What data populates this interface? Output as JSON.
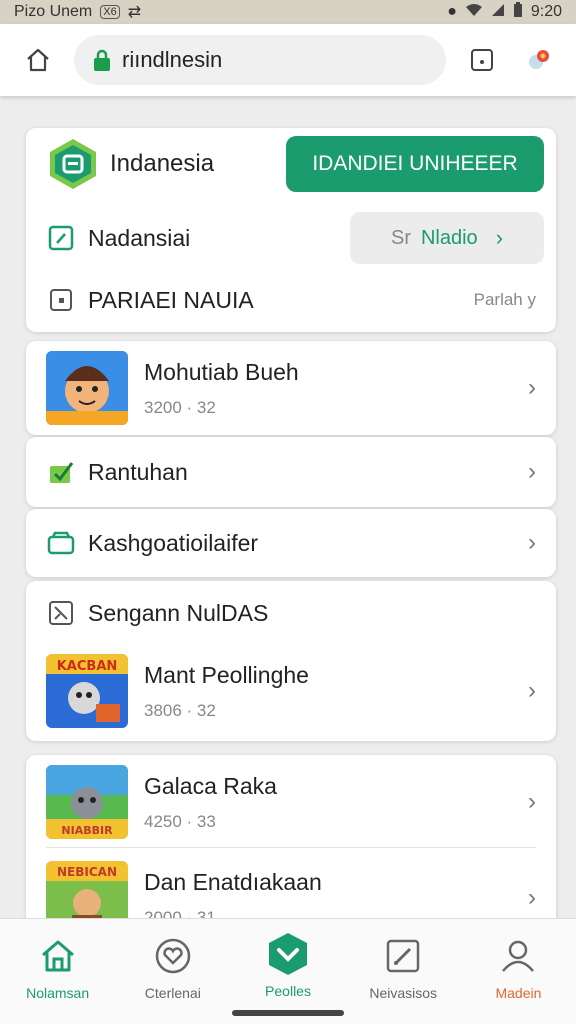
{
  "status_bar": {
    "left_text": "Pizo Unem",
    "badge": "X6",
    "time": "9:20"
  },
  "browser": {
    "url": "riındlnesin"
  },
  "top_card": {
    "brand_title": "Indanesia",
    "primary_button": "IDANDIEI UNIHEEER",
    "row2_label": "Nadansiai",
    "secondary_button_prefix": "Sr",
    "secondary_button_label": "Nladio",
    "row3_label": "PARIAEI NAUIA",
    "row3_value": "Parlah y"
  },
  "list_card_1": {
    "title": "Mohutiab Bueh",
    "sub": "3200 · 32"
  },
  "list_row_rantuhan": {
    "label": "Rantuhan"
  },
  "list_row_kash": {
    "label": "Kashgoatioilaifer"
  },
  "section_card": {
    "header": "Sengann NulDAS",
    "game_title": "Mant Peollinghe",
    "game_sub": "3806 · 32",
    "thumb_text": "KACBAN"
  },
  "bottom_card": {
    "game1_title": "Galaca Raka",
    "game1_sub": "4250 · 33",
    "game1_thumb_text": "NIABBIR",
    "game2_title": "Dan Enatdıakaan",
    "game2_sub": "2000 · 31",
    "game2_thumb_text": "NEBICAN"
  },
  "bottom_nav": {
    "items": [
      {
        "label": "Nolamsan",
        "color": "#1a9c6e"
      },
      {
        "label": "Cterlenai",
        "color": "#666666"
      },
      {
        "label": "Peolles",
        "color": "#1a9c6e"
      },
      {
        "label": "Neivasisos",
        "color": "#666666"
      },
      {
        "label": "Madein",
        "color": "#e2662c"
      }
    ]
  },
  "colors": {
    "accent": "#1a9c6e",
    "orange": "#e2662c"
  }
}
